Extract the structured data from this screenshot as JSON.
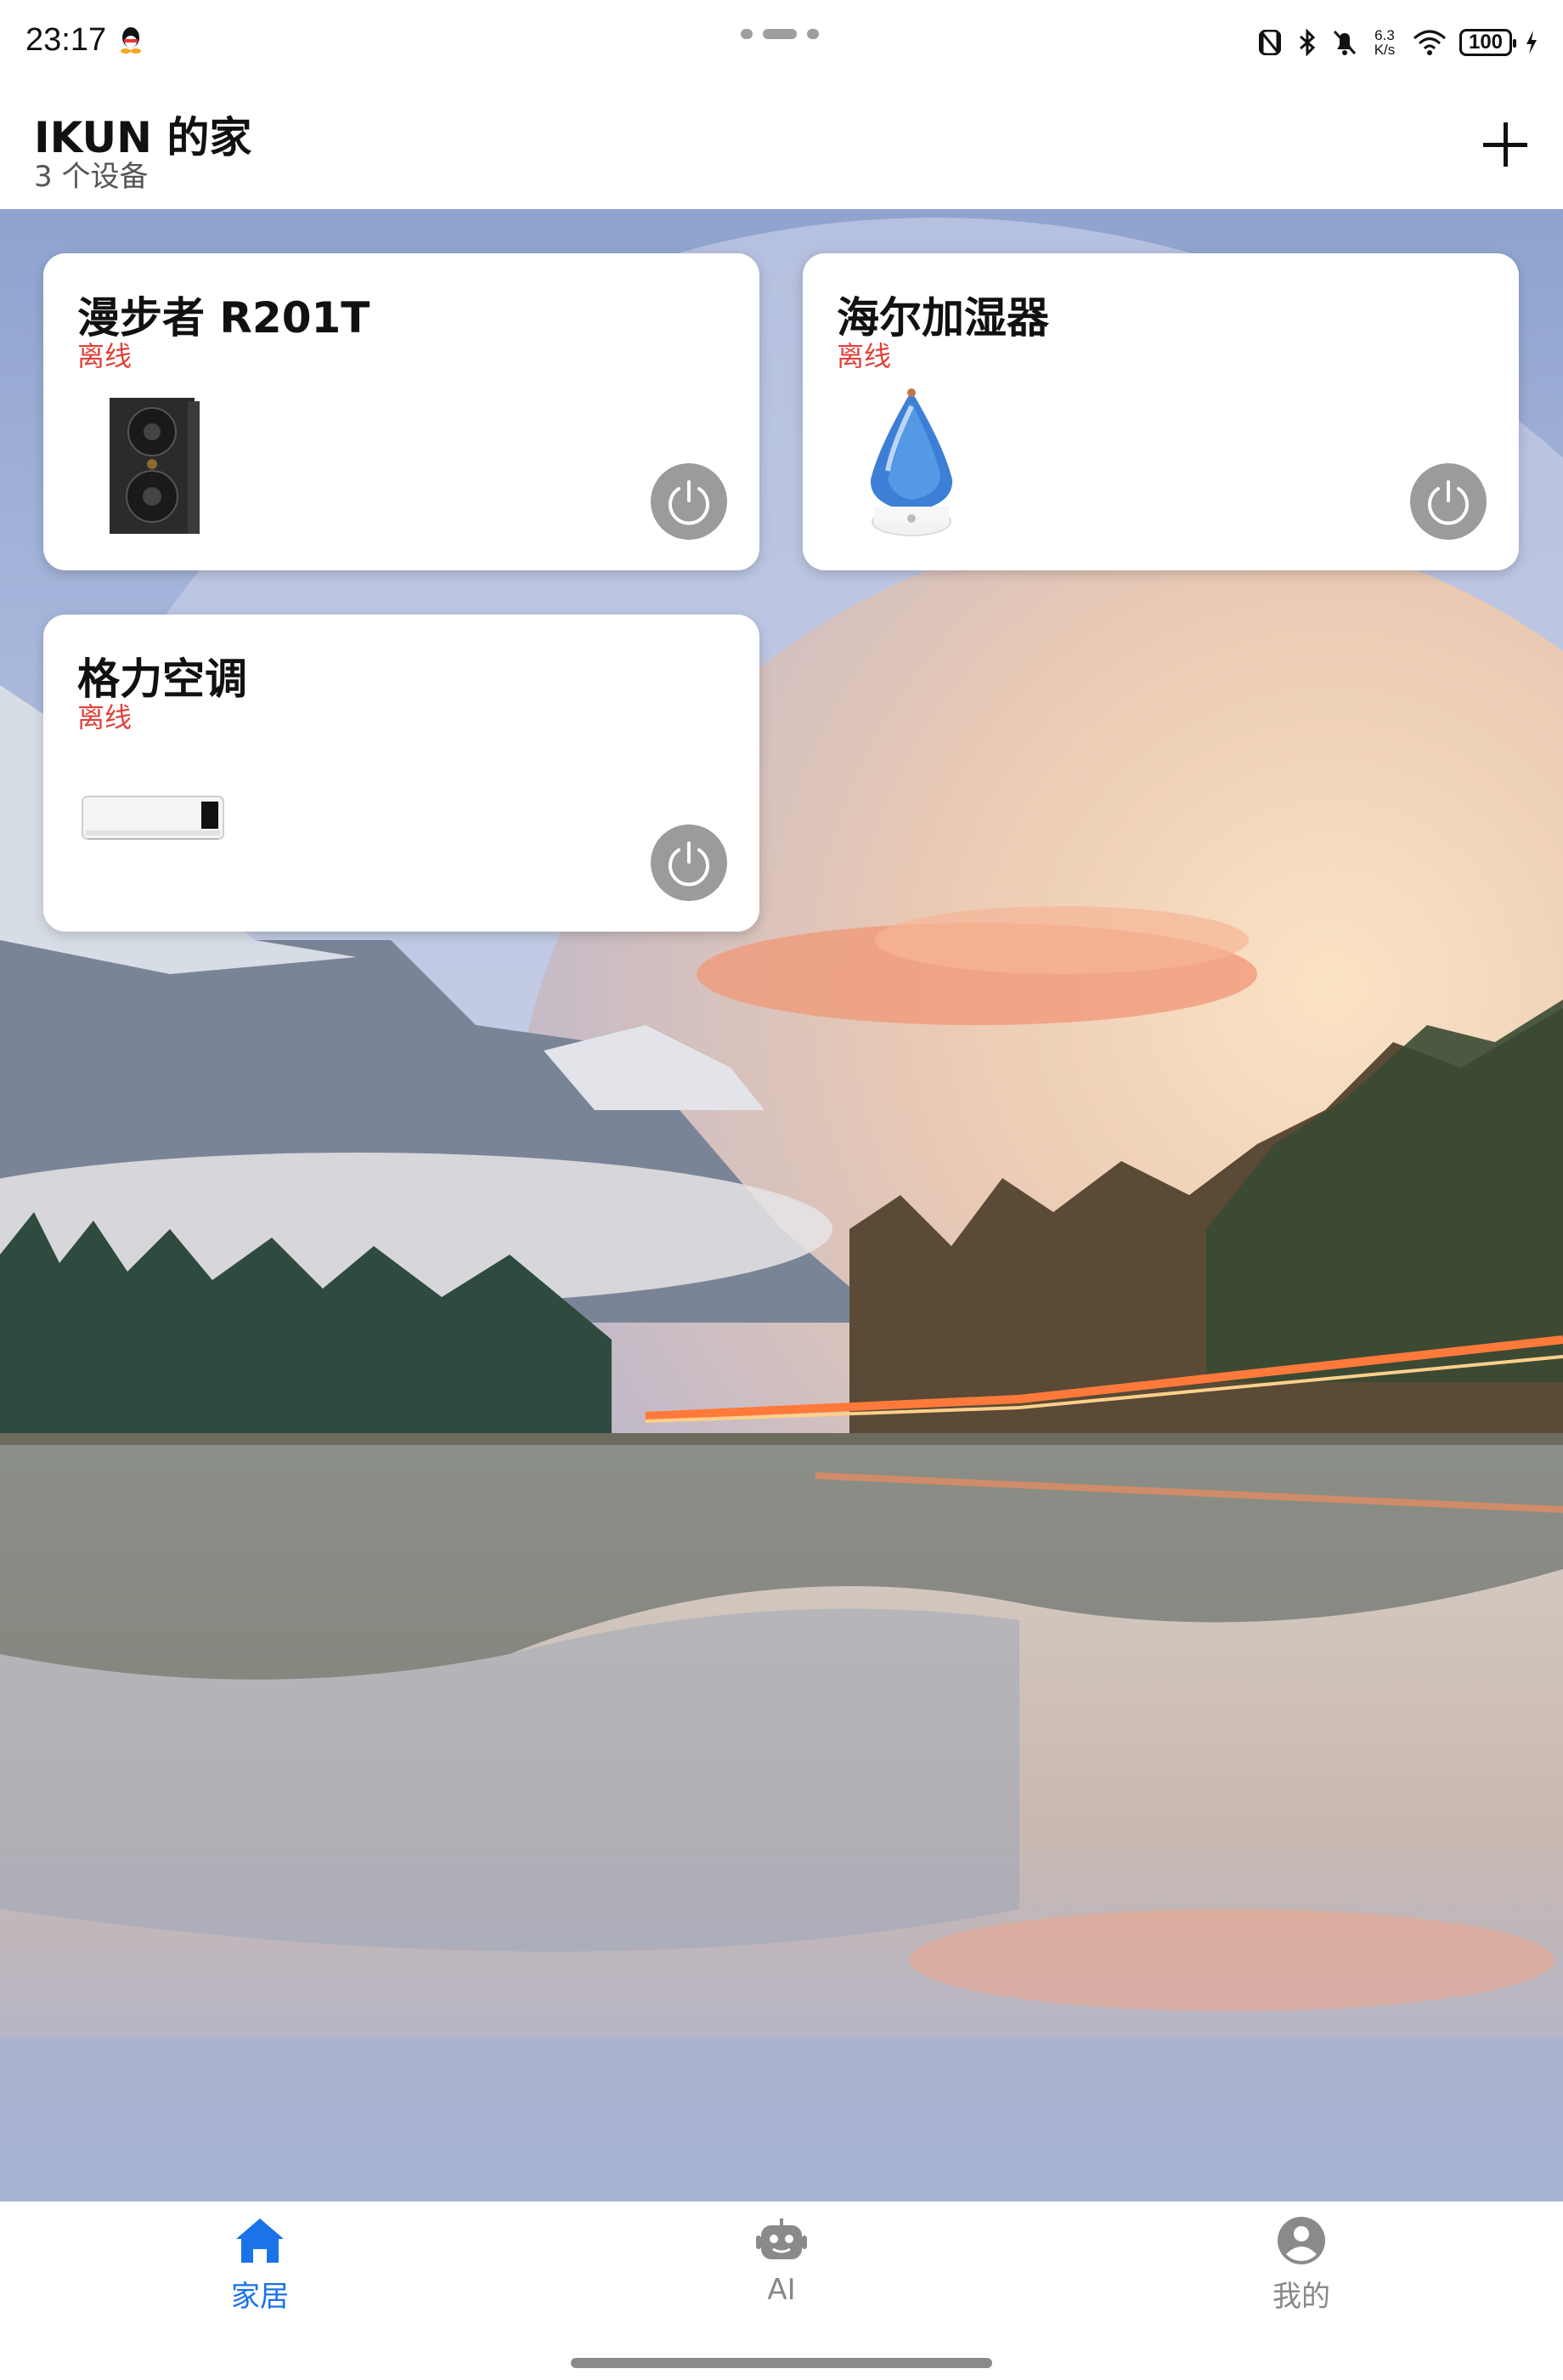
{
  "status_bar": {
    "time": "23:17",
    "net_speed_value": "6.3",
    "net_speed_unit": "K/s",
    "battery": "100",
    "icons": [
      "qq-icon",
      "nfc-icon",
      "bluetooth-icon",
      "mute-bell-icon",
      "wifi-icon",
      "battery-icon",
      "charging-icon"
    ]
  },
  "header": {
    "home_name": "IKUN 的家",
    "device_count": "3 个设备",
    "add_icon": "plus-icon"
  },
  "devices": [
    {
      "name": "漫步者 R201T",
      "status": "离线",
      "image": "speaker-image",
      "power_icon": "power-icon"
    },
    {
      "name": "海尔加湿器",
      "status": "离线",
      "image": "humidifier-image",
      "power_icon": "power-icon"
    },
    {
      "name": "格力空调",
      "status": "离线",
      "image": "air-conditioner-image",
      "power_icon": "power-icon"
    }
  ],
  "bottom_nav": {
    "items": [
      {
        "label": "家居",
        "icon": "home-icon",
        "active": true
      },
      {
        "label": "AI",
        "icon": "robot-icon",
        "active": false
      },
      {
        "label": "我的",
        "icon": "profile-icon",
        "active": false
      }
    ]
  },
  "colors": {
    "accent": "#1a73e8",
    "offline": "#e0413a",
    "power_button": "#9b9b9b",
    "inactive_nav": "#888888"
  }
}
